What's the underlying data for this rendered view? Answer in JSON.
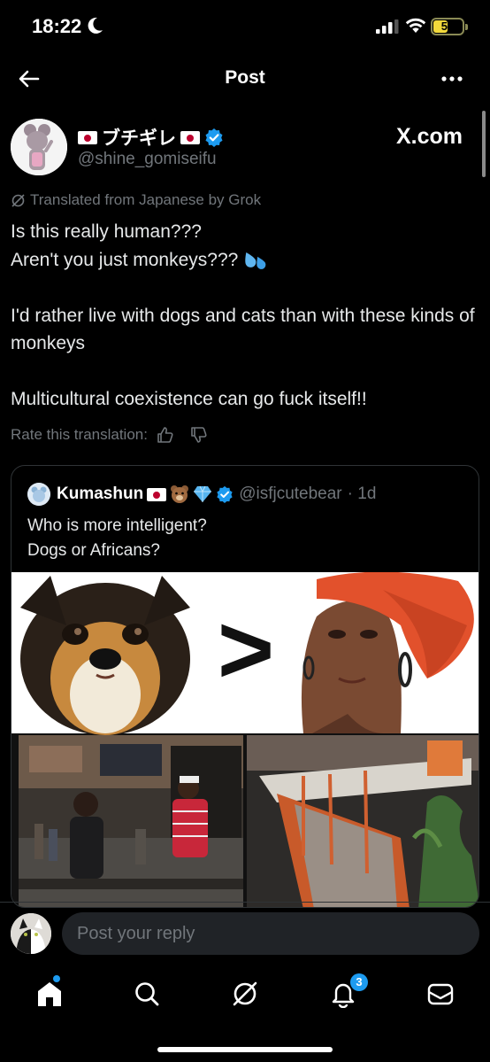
{
  "status_bar": {
    "time": "18:22",
    "battery": "50",
    "battery_level": 0.5
  },
  "header": {
    "title": "Post"
  },
  "post": {
    "display_name": "ブチギレ",
    "handle": "@shine_gomiseifu",
    "source_label": "X.com",
    "translated_label": "Translated from Japanese by Grok",
    "lines": [
      "Is this really human???",
      "Aren't you just monkeys??? ",
      "I'd rather live with dogs and cats than with these kinds of monkeys",
      "Multicultural coexistence can go fuck itself!!"
    ],
    "rate_label": "Rate this translation:"
  },
  "quote": {
    "name": "Kumashun",
    "handle": "@isfjcutebear",
    "time": "· 1d",
    "lines": [
      "Who is more intelligent?",
      "Dogs or Africans?"
    ],
    "image_symbol": ">"
  },
  "reply": {
    "placeholder": "Post your reply"
  },
  "tabbar": {
    "notification_count": "3"
  },
  "colors": {
    "accent": "#1d9bf0",
    "background": "#000000",
    "muted": "#71767b"
  }
}
